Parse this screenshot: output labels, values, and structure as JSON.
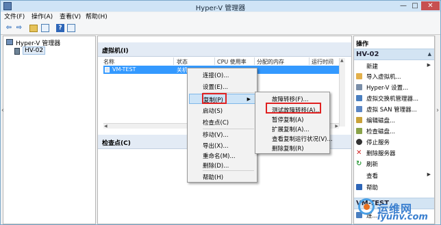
{
  "window": {
    "title": "Hyper-V 管理器"
  },
  "menu": [
    "文件(F)",
    "操作(A)",
    "查看(V)",
    "帮助(H)"
  ],
  "tree": {
    "root": "Hyper-V 管理器",
    "server": "HV-02"
  },
  "vm_section": {
    "title": "虚拟机(I)",
    "columns": [
      "名称",
      "状态",
      "CPU 使用率",
      "分配的内存",
      "运行时间"
    ],
    "rows": [
      {
        "name": "VM-TEST",
        "state": "关机"
      }
    ]
  },
  "checkpoint_section": {
    "title": "检查点(C)"
  },
  "context_menu": {
    "items": [
      "连接(O)...",
      "设置(E)...",
      "复制(P)",
      "启动(S)",
      "检查点(C)",
      "移动(V)...",
      "导出(X)...",
      "重命名(M)...",
      "删除(D)...",
      "帮助(H)"
    ],
    "highlighted": "复制(P)"
  },
  "submenu": {
    "items": [
      "故障转移(F)...",
      "测试故障转移(A)...",
      "暂停复制(A)",
      "扩展复制(A)...",
      "查看复制运行状况(V)...",
      "删除复制(R)"
    ],
    "highlighted": "测试故障转移(A)..."
  },
  "actions": {
    "title": "操作",
    "group1": "HV-02",
    "items": [
      "新建",
      "导入虚拟机...",
      "Hyper-V 设置...",
      "虚拟交换机管理器...",
      "虚拟 SAN 管理器...",
      "编辑磁盘...",
      "检查磁盘...",
      "停止服务",
      "删除服务器",
      "刷新",
      "查看",
      "帮助"
    ],
    "group2": "VM-TEST",
    "group2_items": [
      "连..."
    ]
  },
  "watermark": {
    "brand": "运维网",
    "url": "iyunv.com"
  },
  "colors": {
    "selection": "#3399ff",
    "highlight_box": "#e02020",
    "group_header": "#d3e4f3"
  }
}
